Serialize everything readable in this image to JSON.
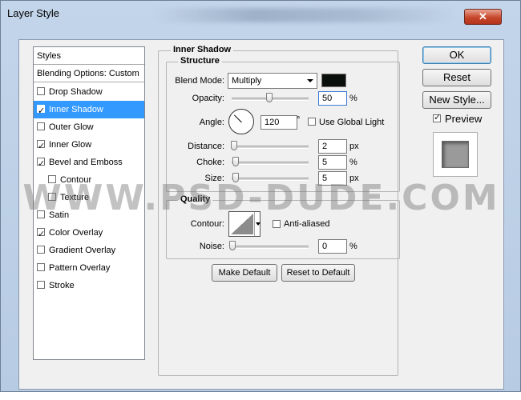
{
  "window": {
    "title": "Layer Style",
    "close_glyph": "✕"
  },
  "left_panel": {
    "items": [
      {
        "label": "Styles",
        "checkbox": false
      },
      {
        "label": "Blending Options: Custom",
        "checkbox": false
      },
      {
        "label": "Drop Shadow",
        "checkbox": true,
        "checked": false
      },
      {
        "label": "Inner Shadow",
        "checkbox": true,
        "checked": true,
        "selected": true
      },
      {
        "label": "Outer Glow",
        "checkbox": true,
        "checked": false
      },
      {
        "label": "Inner Glow",
        "checkbox": true,
        "checked": true
      },
      {
        "label": "Bevel and Emboss",
        "checkbox": true,
        "checked": true
      },
      {
        "label": "Contour",
        "checkbox": true,
        "checked": false,
        "indent": true
      },
      {
        "label": "Texture",
        "checkbox": true,
        "checked": false,
        "indent": true
      },
      {
        "label": "Satin",
        "checkbox": true,
        "checked": false
      },
      {
        "label": "Color Overlay",
        "checkbox": true,
        "checked": true
      },
      {
        "label": "Gradient Overlay",
        "checkbox": true,
        "checked": false
      },
      {
        "label": "Pattern Overlay",
        "checkbox": true,
        "checked": false
      },
      {
        "label": "Stroke",
        "checkbox": true,
        "checked": false
      }
    ]
  },
  "inner_shadow": {
    "section_title": "Inner Shadow",
    "structure": {
      "title": "Structure",
      "blend_mode_label": "Blend Mode:",
      "blend_mode_value": "Multiply",
      "swatch_color": "#0b0f0b",
      "opacity_label": "Opacity:",
      "opacity_value": "50",
      "opacity_unit": "%",
      "angle_label": "Angle:",
      "angle_value": "120",
      "angle_unit": "°",
      "global_light_label": "Use Global Light",
      "global_light_checked": false,
      "distance_label": "Distance:",
      "distance_value": "2",
      "distance_unit": "px",
      "choke_label": "Choke:",
      "choke_value": "5",
      "choke_unit": "%",
      "size_label": "Size:",
      "size_value": "5",
      "size_unit": "px"
    },
    "quality": {
      "title": "Quality",
      "contour_label": "Contour:",
      "anti_aliased_label": "Anti-aliased",
      "anti_aliased_checked": false,
      "noise_label": "Noise:",
      "noise_value": "0",
      "noise_unit": "%"
    },
    "make_default_label": "Make Default",
    "reset_default_label": "Reset to Default"
  },
  "right": {
    "ok_label": "OK",
    "reset_label": "Reset",
    "new_style_label": "New Style...",
    "preview_label": "Preview",
    "preview_checked": true
  },
  "watermark": "WWW.PSD-DUDE.COM"
}
